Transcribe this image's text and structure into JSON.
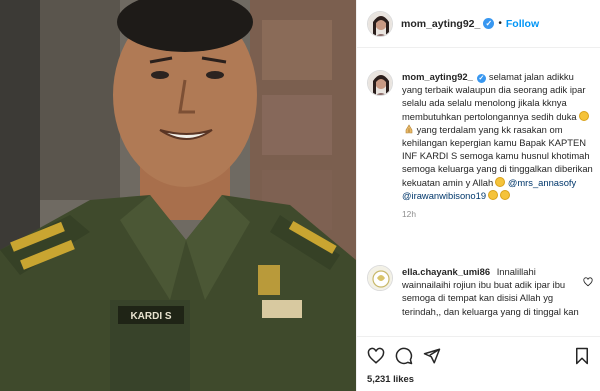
{
  "post": {
    "author": "mom_ayting92_",
    "verified_mark": "✓",
    "separator": "•",
    "follow_label": "Follow",
    "likes": "5,231 likes"
  },
  "photo": {
    "nametag": "KARDI S",
    "colors": {
      "uniform": "#3f4a2c",
      "background": "#6e6a63"
    }
  },
  "caption": {
    "username": "mom_ayting92_",
    "text": "selamat jalan adikku yang terbaik walaupun dia seorang adik ipar selalu ada selalu menolong jikala kknya membutuhkan pertolongannya sedih duka",
    "text2": "yang terdalam yang kk rasakan om kehilangan kepergian kamu Bapak KAPTEN INF KARDI S semoga kamu husnul khotimah semoga keluarga yang di tinggalkan diberikan kekuatan amin y Allah",
    "mention1": "@mrs_annasofy",
    "mention2": "@irawanwibisono19",
    "time": "12h"
  },
  "comment1": {
    "username": "ella.chayank_umi86",
    "text": "Innalillahi wainnailaihi rojiun ibu buat adik ipar ibu semoga di tempat kan disisi Allah yg terindah,, dan keluarga yang di tinggal kan"
  },
  "icons": {
    "like": "heart-icon",
    "comment": "comment-icon",
    "share": "share-icon",
    "save": "bookmark-icon",
    "comment_like": "small-heart-icon"
  },
  "colors": {
    "link": "#0095f6",
    "mention": "#00376b",
    "muted": "#8e8e8e",
    "verified": "#3897f0"
  }
}
